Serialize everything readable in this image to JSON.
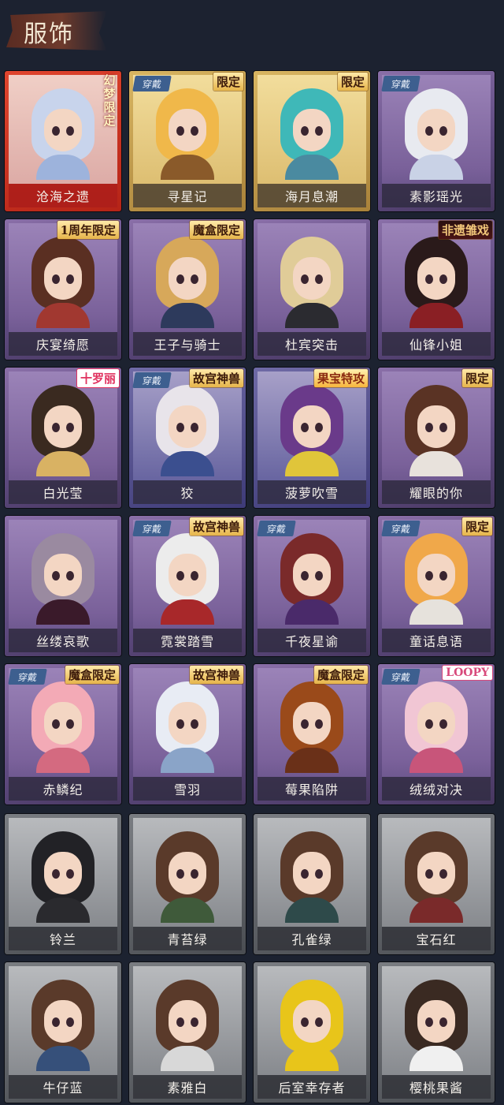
{
  "header": {
    "title": "服饰"
  },
  "worn_label": "穿戴",
  "costumes": [
    {
      "name": "沧海之遗",
      "style": "red",
      "badge": "幻梦限定",
      "vertical": true,
      "worn": false,
      "hair": "#c8d4ec",
      "outfit": "#9db3dc"
    },
    {
      "name": "寻星记",
      "style": "gold",
      "badge": "限定",
      "worn": true,
      "hair": "#f0b84a",
      "outfit": "#8a5a2a"
    },
    {
      "name": "海月息潮",
      "style": "gold",
      "badge": "限定",
      "worn": false,
      "hair": "#3fb8b8",
      "outfit": "#4a8aa0"
    },
    {
      "name": "素影瑶光",
      "style": "purple",
      "badge": "",
      "worn": true,
      "hair": "#e8eaf0",
      "outfit": "#c9d2e6"
    },
    {
      "name": "庆宴绮愿",
      "style": "purple",
      "badge": "1周年限定",
      "worn": false,
      "hair": "#5a2f22",
      "outfit": "#a13830"
    },
    {
      "name": "王子与骑士",
      "style": "purple",
      "badge": "魔盒限定",
      "worn": false,
      "hair": "#d7a85a",
      "outfit": "#2d3a5c"
    },
    {
      "name": "杜宾突击",
      "style": "purple",
      "badge": "",
      "worn": false,
      "hair": "#e0cc98",
      "outfit": "#2b2b30"
    },
    {
      "name": "仙锋小姐",
      "style": "purple",
      "badge": "非遗雏戏",
      "badgeClass": "red-text",
      "worn": false,
      "hair": "#2a1a1a",
      "outfit": "#8a1f24"
    },
    {
      "name": "白光莹",
      "style": "purple",
      "badge": "十罗丽",
      "badgeClass": "pink",
      "worn": false,
      "hair": "#3a2a20",
      "outfit": "#d9b263"
    },
    {
      "name": "狡",
      "style": "navy",
      "badge": "故宫神兽",
      "worn": true,
      "hair": "#e8e4ea",
      "outfit": "#3b4f8f"
    },
    {
      "name": "菠萝吹雪",
      "style": "navy",
      "badge": "果宝特攻",
      "badgeClass": "fruit",
      "worn": false,
      "hair": "#6a3a8a",
      "outfit": "#e0c53a"
    },
    {
      "name": "耀眼的你",
      "style": "purple",
      "badge": "限定",
      "worn": false,
      "hair": "#5a3324",
      "outfit": "#e8e2dc"
    },
    {
      "name": "丝缕哀歌",
      "style": "purple",
      "badge": "",
      "worn": false,
      "hair": "#9a8aa0",
      "outfit": "#3a1a2a"
    },
    {
      "name": "霓裳踏雪",
      "style": "purple",
      "badge": "故宫神兽",
      "worn": true,
      "hair": "#ececec",
      "outfit": "#a8282a"
    },
    {
      "name": "千夜星谕",
      "style": "purple",
      "badge": "",
      "worn": true,
      "hair": "#7a2a2a",
      "outfit": "#4a2a6a"
    },
    {
      "name": "童话息语",
      "style": "purple",
      "badge": "限定",
      "worn": true,
      "hair": "#f0a84a",
      "outfit": "#e6e2dc"
    },
    {
      "name": "赤鳞纪",
      "style": "purple",
      "badge": "魔盒限定",
      "worn": true,
      "hair": "#f3aab6",
      "outfit": "#d46a80"
    },
    {
      "name": "雪羽",
      "style": "purple",
      "badge": "故宫神兽",
      "worn": false,
      "hair": "#e8ecf4",
      "outfit": "#8aa4c8"
    },
    {
      "name": "莓果陷阱",
      "style": "purple",
      "badge": "魔盒限定",
      "worn": false,
      "hair": "#9a4a1a",
      "outfit": "#6a3018"
    },
    {
      "name": "绒绒对决",
      "style": "purple",
      "badge": "LOOPY",
      "badgeClass": "loopy",
      "worn": true,
      "hair": "#f1c6d4",
      "outfit": "#c8557a"
    },
    {
      "name": "铃兰",
      "style": "grey",
      "badge": "",
      "worn": false,
      "hair": "#222226",
      "outfit": "#2a2a2e"
    },
    {
      "name": "青苔绿",
      "style": "grey",
      "badge": "",
      "worn": false,
      "hair": "#5a3a2a",
      "outfit": "#3f5a3a"
    },
    {
      "name": "孔雀绿",
      "style": "grey",
      "badge": "",
      "worn": false,
      "hair": "#5a3a2a",
      "outfit": "#2e4a4a"
    },
    {
      "name": "宝石红",
      "style": "grey",
      "badge": "",
      "worn": false,
      "hair": "#5a3a2a",
      "outfit": "#7a2a2a"
    },
    {
      "name": "牛仔蓝",
      "style": "grey",
      "badge": "",
      "worn": false,
      "hair": "#5a3a2a",
      "outfit": "#36507a"
    },
    {
      "name": "素雅白",
      "style": "grey",
      "badge": "",
      "worn": false,
      "hair": "#5a3a2a",
      "outfit": "#d8d8d8"
    },
    {
      "name": "后室幸存者",
      "style": "grey",
      "badge": "",
      "worn": false,
      "hair": "#e8c51a",
      "outfit": "#e8c51a"
    },
    {
      "name": "樱桃果酱",
      "style": "grey",
      "badge": "",
      "worn": false,
      "hair": "#3a2a22",
      "outfit": "#f0f0f0"
    }
  ]
}
